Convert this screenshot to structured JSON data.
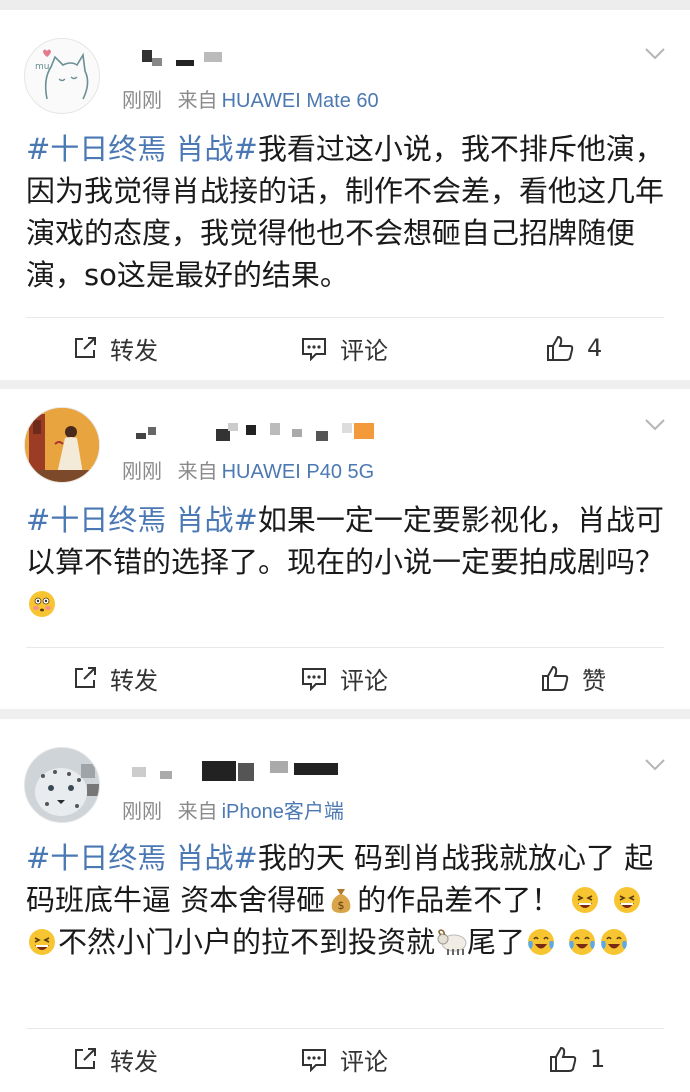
{
  "posts": [
    {
      "time": "刚刚",
      "from": "来自",
      "device": "HUAWEI Mate 60",
      "content": {
        "topic": "#十日终焉 肖战#",
        "text": "我看过这小说，我不排斥他演，因为我觉得肖战接的话，制作不会差，看他这几年演戏的态度，我觉得他也不会想砸自己招牌随便演，so这是最好的结果。"
      },
      "actions": {
        "repost": "转发",
        "comment": "评论",
        "like": "4"
      }
    },
    {
      "time": "刚刚",
      "from": "来自",
      "device": "HUAWEI P40 5G",
      "content": {
        "topic": "#十日终焉 肖战#",
        "text": "如果一定一定要影视化，肖战可以算不错的选择了。现在的小说一定要拍成剧吗？"
      },
      "actions": {
        "repost": "转发",
        "comment": "评论",
        "like": "赞"
      }
    },
    {
      "time": "刚刚",
      "from": "来自",
      "device": "iPhone客户端",
      "content": {
        "topic": "#十日终焉 肖战#",
        "text_a": "我的天 码到肖战我就放心了 起码班底牛逼 资本舍得砸",
        "text_b": "的作品差不了！",
        "text_c": "不然小门小户的拉不到投资就",
        "text_d": "尾了"
      },
      "actions": {
        "repost": "转发",
        "comment": "评论",
        "like": "1"
      }
    }
  ],
  "colors": {
    "topic": "#4a78b4",
    "device": "#4c79b2",
    "meta": "#8a8a8a",
    "emoji": "#f7c531"
  },
  "icons": [
    "repost-icon",
    "comment-icon",
    "thumbs-up-icon",
    "chevron-down-icon",
    "flushed-emoji",
    "laughing-emoji",
    "crying-laughing-emoji",
    "money-bag-emoji",
    "ram-emoji"
  ]
}
